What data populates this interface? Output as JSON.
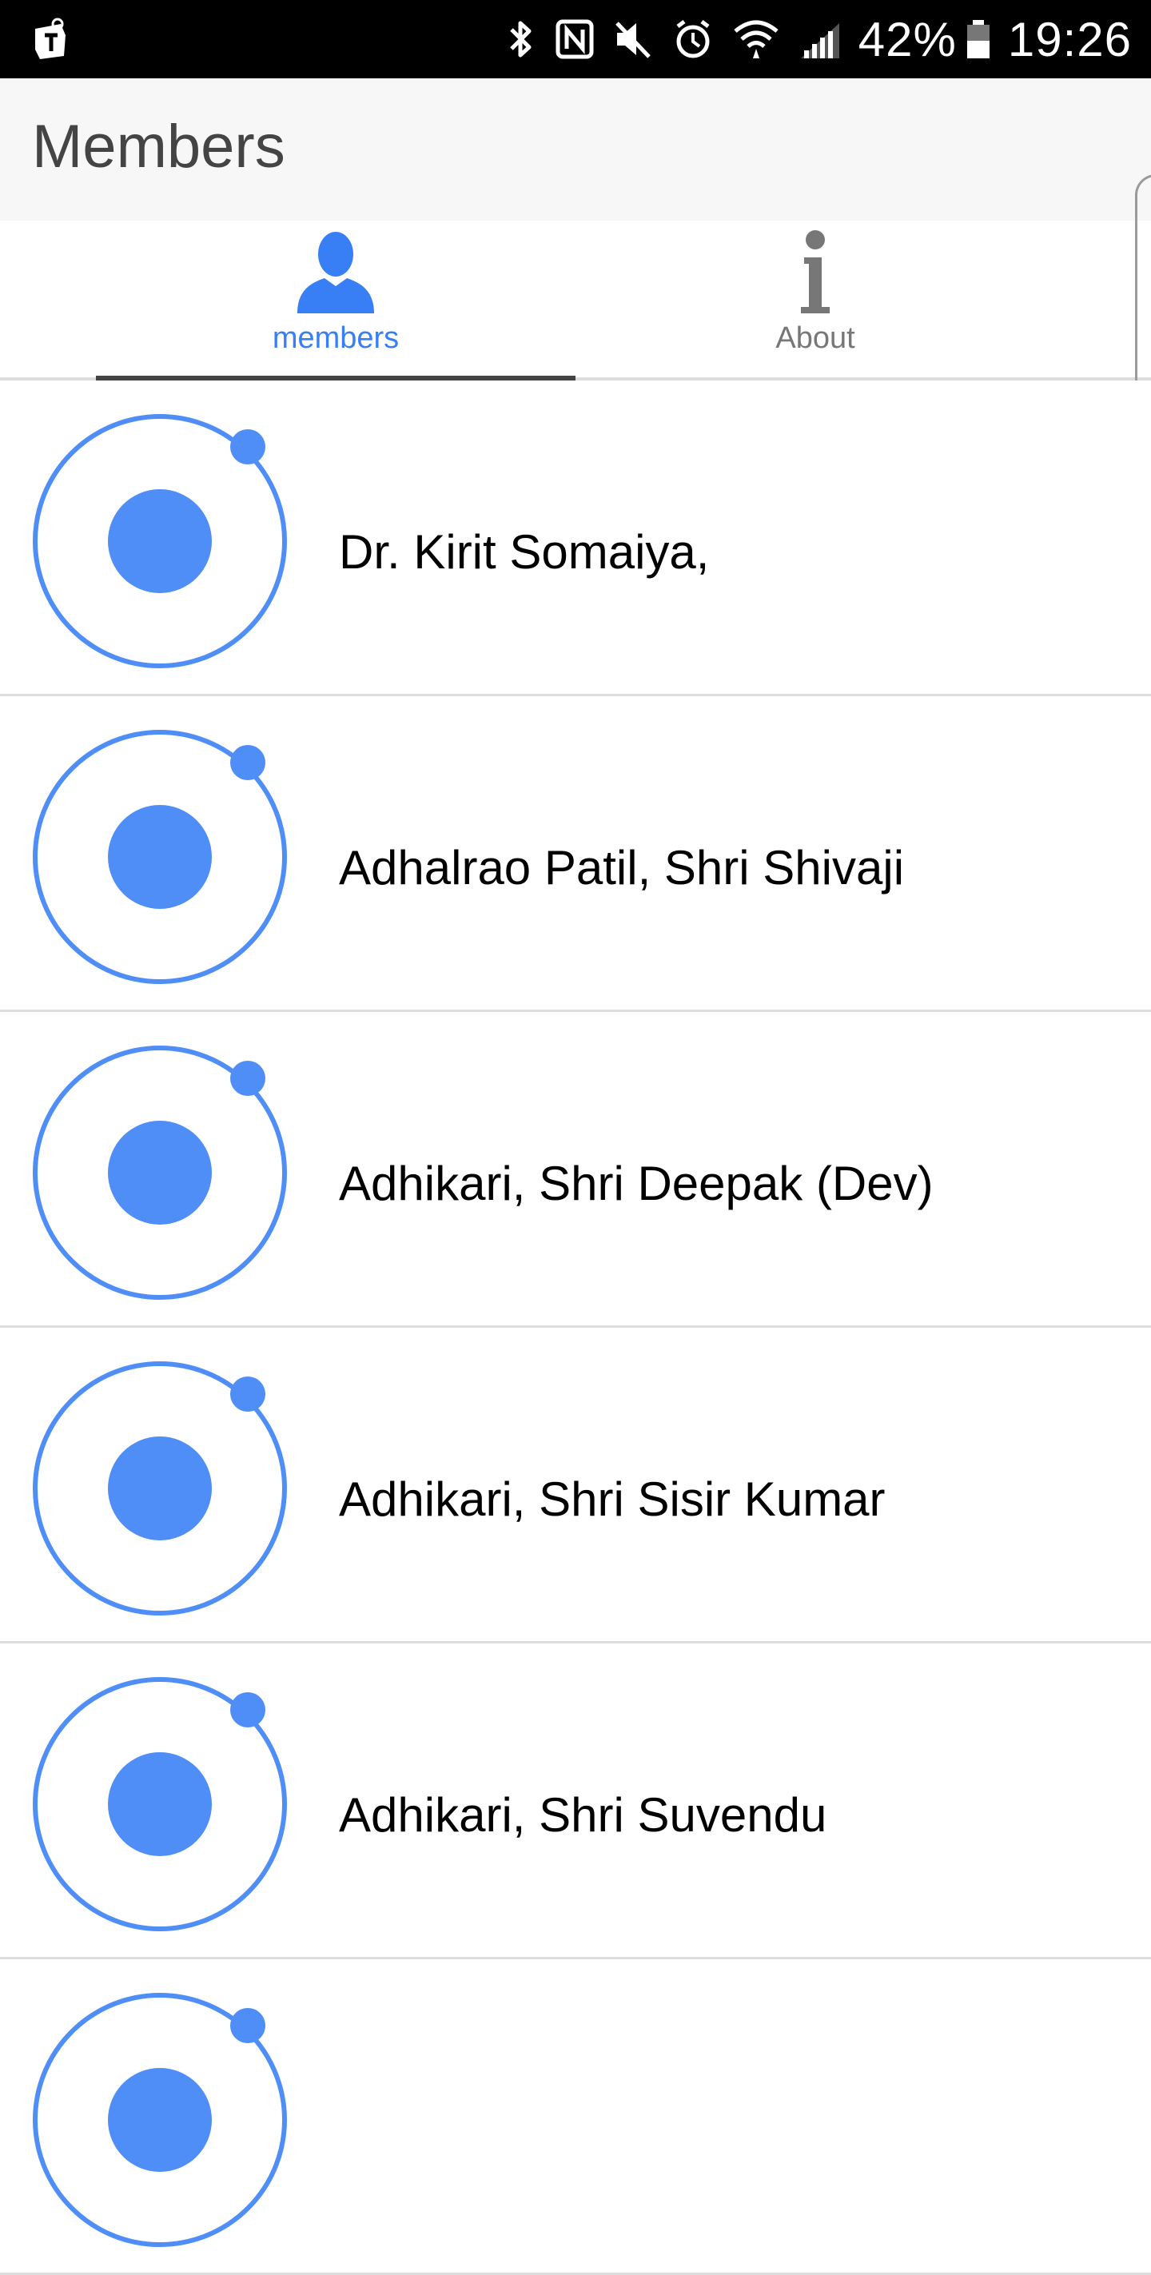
{
  "status_bar": {
    "battery": "42%",
    "time": "19:26",
    "icons": [
      "t-mobile-icon",
      "bluetooth-icon",
      "nfc-icon",
      "mute-icon",
      "alarm-icon",
      "wifi-icon",
      "signal-icon",
      "battery-icon"
    ]
  },
  "header": {
    "title": "Members"
  },
  "tabs": [
    {
      "label": "members",
      "icon": "person-icon",
      "active": true
    },
    {
      "label": "About",
      "icon": "info-icon",
      "active": false
    }
  ],
  "colors": {
    "accent": "#387ef5",
    "avatar": "#4f8ef7"
  },
  "members": [
    {
      "name": "Dr. Kirit Somaiya,"
    },
    {
      "name": "Adhalrao Patil, Shri Shivaji"
    },
    {
      "name": "Adhikari, Shri Deepak (Dev)"
    },
    {
      "name": "Adhikari, Shri Sisir Kumar"
    },
    {
      "name": "Adhikari, Shri Suvendu"
    },
    {
      "name": ""
    }
  ]
}
